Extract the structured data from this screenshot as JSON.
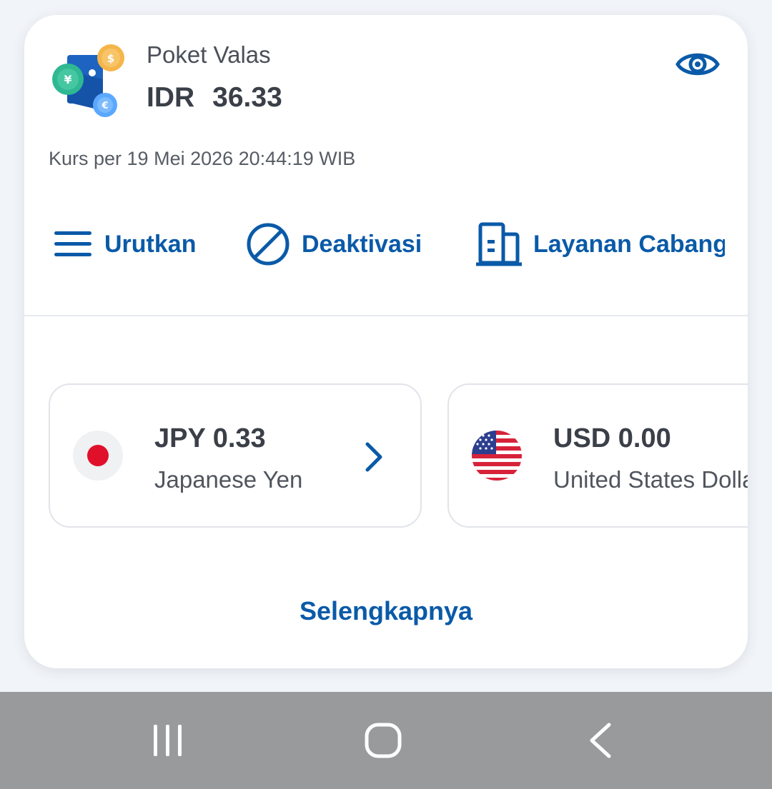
{
  "pocket": {
    "title": "Poket Valas",
    "currency": "IDR",
    "amount": "36.33",
    "rate_info": "Kurs per 19 Mei 2026 20:44:19 WIB"
  },
  "actions": {
    "sort": "Urutkan",
    "deactivate": "Deaktivasi",
    "branch": "Layanan Cabang"
  },
  "currencies": [
    {
      "amount": "JPY 0.33",
      "name": "Japanese Yen"
    },
    {
      "amount": "USD 0.00",
      "name": "United States Dollar"
    }
  ],
  "more_label": "Selengkapnya",
  "colors": {
    "accent": "#0a5aa8",
    "text_dark": "#3a3f48",
    "navbar": "#999a9c"
  }
}
